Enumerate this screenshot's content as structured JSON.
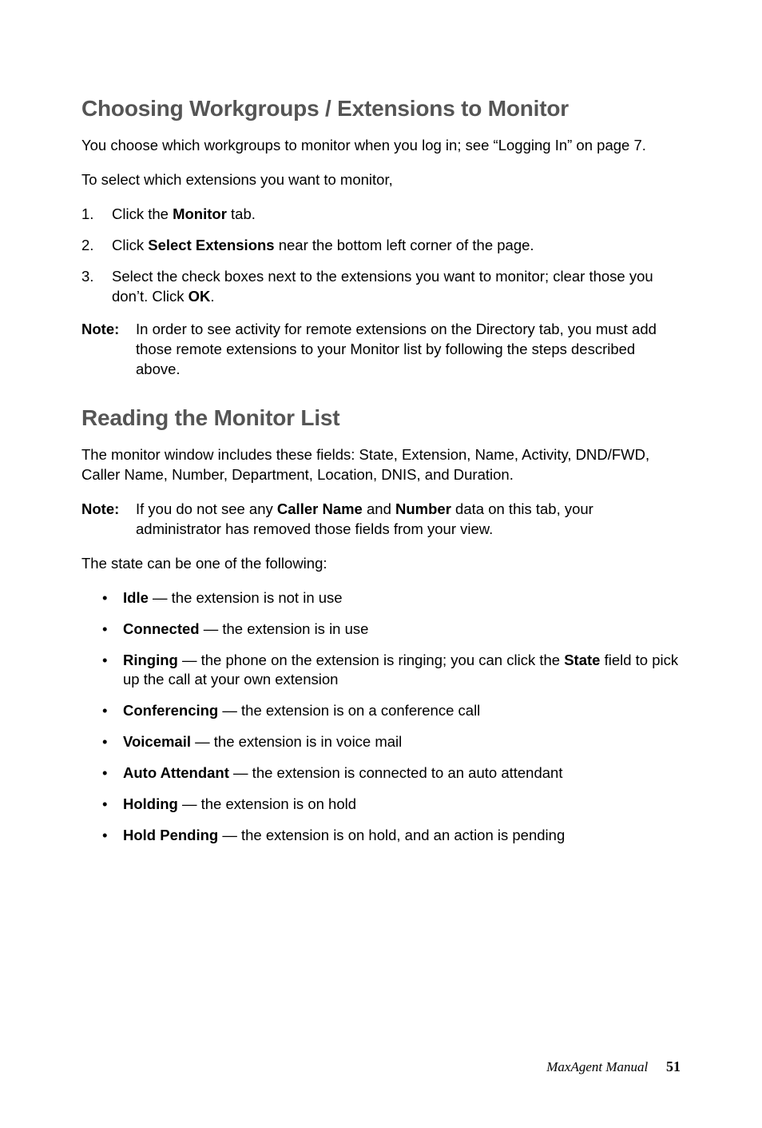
{
  "section1": {
    "heading": "Choosing Workgroups / Extensions to Monitor",
    "intro": "You choose which workgroups to monitor when you log in; see “Logging In” on page 7.",
    "lead": "To select which extensions you want to monitor,",
    "steps": [
      {
        "num": "1.",
        "pre": "Click the ",
        "bold": "Monitor",
        "post": " tab."
      },
      {
        "num": "2.",
        "pre": "Click ",
        "bold": "Select Extensions",
        "post": " near the bottom left corner of the page."
      },
      {
        "num": "3.",
        "pre": "Select the check boxes next to the extensions you want to monitor; clear those you don’t. Click ",
        "bold": "OK",
        "post": "."
      }
    ],
    "note": {
      "label": "Note:",
      "text": "In order to see activity for remote extensions on the Directory tab, you must add those remote extensions to your Monitor list by following the steps described above."
    }
  },
  "section2": {
    "heading": "Reading the Monitor List",
    "intro": "The monitor window includes these fields: State, Extension, Name, Activity, DND/FWD, Caller Name, Number, Department, Location, DNIS, and Duration.",
    "note": {
      "label": "Note:",
      "pre": "If you do not see any ",
      "b1": "Caller Name",
      "mid": " and ",
      "b2": "Number",
      "post": " data on this tab, your administrator has removed those fields from your view."
    },
    "lead": "The state can be one of the following:",
    "states": [
      {
        "term": "Idle",
        "desc": " — the extension is not in use"
      },
      {
        "term": "Connected",
        "desc": " — the extension is in use"
      },
      {
        "term": "Ringing",
        "desc_pre": " — the phone on the extension is ringing; you can click the ",
        "b": "State",
        "desc_post": " field to pick up the call at your own extension"
      },
      {
        "term": "Conferencing",
        "desc": " — the extension is on a conference call"
      },
      {
        "term": "Voicemail",
        "desc": " — the extension is in voice mail"
      },
      {
        "term": "Auto Attendant",
        "desc": " — the extension is connected to an auto attendant"
      },
      {
        "term": "Holding",
        "desc": " — the extension is on hold"
      },
      {
        "term": "Hold Pending",
        "desc": " — the extension is on hold, and an action is pending"
      }
    ]
  },
  "footer": {
    "title": "MaxAgent Manual",
    "pagenum": "51"
  }
}
